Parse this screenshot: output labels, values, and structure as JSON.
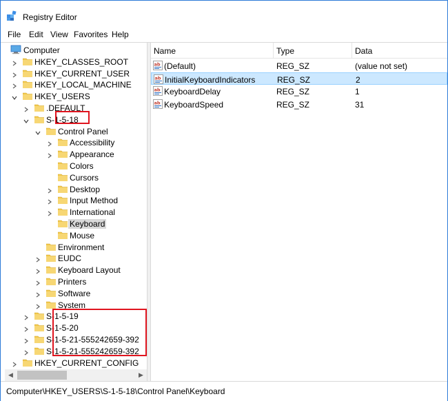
{
  "window": {
    "title": "Registry Editor"
  },
  "menu": [
    "File",
    "Edit",
    "View",
    "Favorites",
    "Help"
  ],
  "tree": [
    {
      "label": "Computer",
      "depth": 0,
      "expander": "expanded",
      "icon": "computer-icon"
    },
    {
      "label": "HKEY_CLASSES_ROOT",
      "depth": 1,
      "expander": "collapsed",
      "icon": "folder-icon"
    },
    {
      "label": "HKEY_CURRENT_USER",
      "depth": 1,
      "expander": "collapsed",
      "icon": "folder-icon"
    },
    {
      "label": "HKEY_LOCAL_MACHINE",
      "depth": 1,
      "expander": "collapsed",
      "icon": "folder-icon"
    },
    {
      "label": "HKEY_USERS",
      "depth": 1,
      "expander": "expanded",
      "icon": "folder-icon"
    },
    {
      "label": ".DEFAULT",
      "depth": 2,
      "expander": "collapsed",
      "icon": "folder-icon"
    },
    {
      "label": "S-1-5-18",
      "depth": 2,
      "expander": "expanded",
      "icon": "folder-icon"
    },
    {
      "label": "Control Panel",
      "depth": 3,
      "expander": "expanded",
      "icon": "folder-icon"
    },
    {
      "label": "Accessibility",
      "depth": 4,
      "expander": "collapsed",
      "icon": "folder-icon"
    },
    {
      "label": "Appearance",
      "depth": 4,
      "expander": "collapsed",
      "icon": "folder-icon"
    },
    {
      "label": "Colors",
      "depth": 4,
      "expander": "none",
      "icon": "folder-icon"
    },
    {
      "label": "Cursors",
      "depth": 4,
      "expander": "none",
      "icon": "folder-icon"
    },
    {
      "label": "Desktop",
      "depth": 4,
      "expander": "collapsed",
      "icon": "folder-icon"
    },
    {
      "label": "Input Method",
      "depth": 4,
      "expander": "collapsed",
      "icon": "folder-icon"
    },
    {
      "label": "International",
      "depth": 4,
      "expander": "collapsed",
      "icon": "folder-icon"
    },
    {
      "label": "Keyboard",
      "depth": 4,
      "expander": "none",
      "icon": "folder-icon",
      "selected": true
    },
    {
      "label": "Mouse",
      "depth": 4,
      "expander": "none",
      "icon": "folder-icon"
    },
    {
      "label": "Environment",
      "depth": 3,
      "expander": "none",
      "icon": "folder-icon"
    },
    {
      "label": "EUDC",
      "depth": 3,
      "expander": "collapsed",
      "icon": "folder-icon"
    },
    {
      "label": "Keyboard Layout",
      "depth": 3,
      "expander": "collapsed",
      "icon": "folder-icon"
    },
    {
      "label": "Printers",
      "depth": 3,
      "expander": "collapsed",
      "icon": "folder-icon"
    },
    {
      "label": "Software",
      "depth": 3,
      "expander": "collapsed",
      "icon": "folder-icon"
    },
    {
      "label": "System",
      "depth": 3,
      "expander": "collapsed",
      "icon": "folder-icon"
    },
    {
      "label": "S-1-5-19",
      "depth": 2,
      "expander": "collapsed",
      "icon": "folder-icon"
    },
    {
      "label": "S-1-5-20",
      "depth": 2,
      "expander": "collapsed",
      "icon": "folder-icon"
    },
    {
      "label": "S-1-5-21-555242659-392",
      "depth": 2,
      "expander": "collapsed",
      "icon": "folder-icon"
    },
    {
      "label": "S-1-5-21-555242659-392",
      "depth": 2,
      "expander": "collapsed",
      "icon": "folder-icon"
    },
    {
      "label": "HKEY_CURRENT_CONFIG",
      "depth": 1,
      "expander": "collapsed",
      "icon": "folder-icon"
    }
  ],
  "columns": {
    "name": "Name",
    "type": "Type",
    "data": "Data"
  },
  "values": [
    {
      "name": "(Default)",
      "type": "REG_SZ",
      "data": "(value not set)",
      "icon": "string-value-icon"
    },
    {
      "name": "InitialKeyboardIndicators",
      "type": "REG_SZ",
      "data": "2",
      "icon": "string-value-icon",
      "selected": true
    },
    {
      "name": "KeyboardDelay",
      "type": "REG_SZ",
      "data": "1",
      "icon": "string-value-icon"
    },
    {
      "name": "KeyboardSpeed",
      "type": "REG_SZ",
      "data": "31",
      "icon": "string-value-icon"
    }
  ],
  "status": {
    "path": "Computer\\HKEY_USERS\\S-1-5-18\\Control Panel\\Keyboard"
  },
  "colors": {
    "accent_border": "#2b79d7",
    "selection_list": "#cce8ff",
    "selection_tree": "#d9d9d9",
    "annotation_red": "#e0141e",
    "folder": "#f2c94c"
  }
}
